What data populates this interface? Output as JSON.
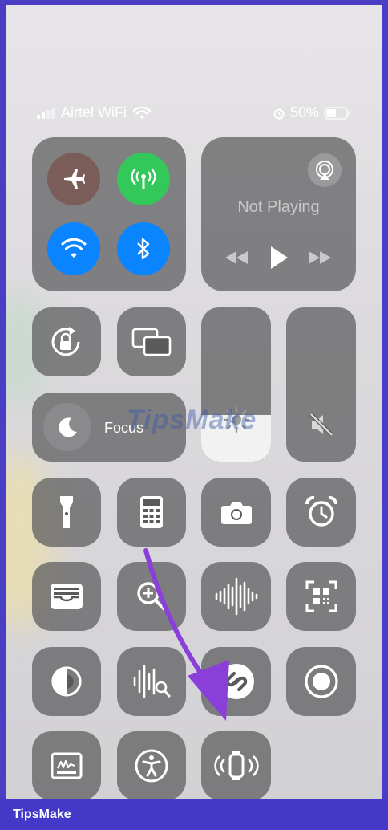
{
  "status_bar": {
    "carrier": "Airtel WiFi",
    "battery_percent": "50%"
  },
  "media": {
    "title": "Not Playing"
  },
  "focus": {
    "label": "Focus"
  },
  "watermark": {
    "text": "TipsMake"
  },
  "footer": {
    "brand": "TipsMake"
  },
  "brightness": {
    "level": 0.3
  },
  "volume": {
    "level": 0.0,
    "muted": true
  },
  "colors": {
    "airplane_off": "#7a5c58",
    "cellular_on": "#34c759",
    "wifi_on": "#0a84ff",
    "bluetooth_on": "#0a84ff",
    "arrow": "#8b3fd9",
    "footer_bg": "#4338c8"
  },
  "icons": [
    "airplane-icon",
    "cellular-icon",
    "wifi-icon",
    "bluetooth-icon",
    "airplay-icon",
    "rewind-icon",
    "play-icon",
    "fast-forward-icon",
    "rotation-lock-icon",
    "screen-mirroring-icon",
    "moon-icon",
    "brightness-icon",
    "mute-icon",
    "flashlight-icon",
    "calculator-icon",
    "camera-icon",
    "alarm-icon",
    "wallet-icon",
    "magnifier-icon",
    "voice-memos-icon",
    "qr-scanner-icon",
    "dark-mode-icon",
    "sound-recognition-icon",
    "shazam-icon",
    "screen-record-icon",
    "notes-icon",
    "accessibility-icon",
    "ping-watch-icon"
  ]
}
